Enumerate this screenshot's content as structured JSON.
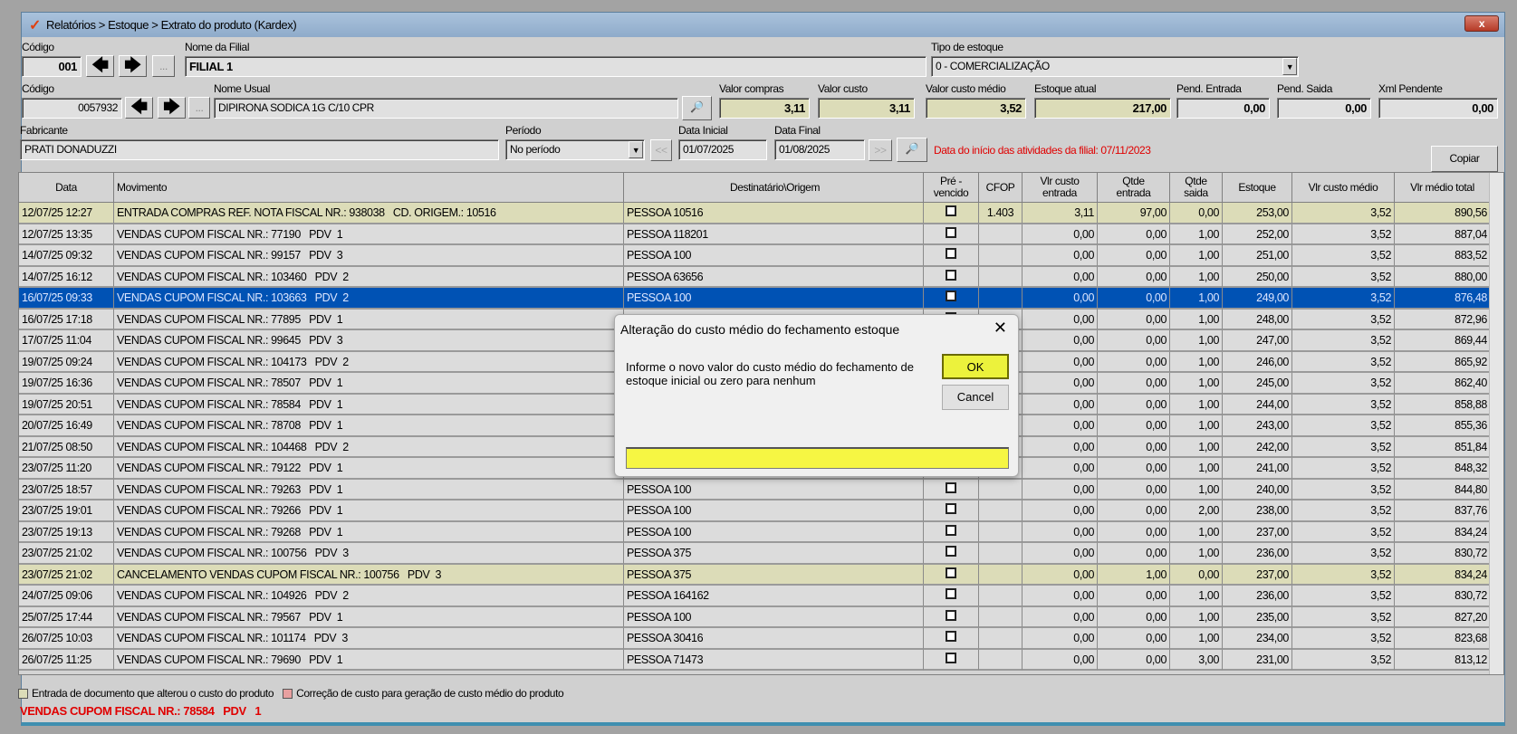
{
  "window": {
    "title": "Relatórios > Estoque > Extrato do produto (Kardex)",
    "close": "x"
  },
  "filial": {
    "codigo_label": "Código",
    "codigo": "001",
    "nome_label": "Nome da Filial",
    "nome": "FILIAL 1",
    "more": "..."
  },
  "tipo_estoque": {
    "label": "Tipo de estoque",
    "value": "0 - COMERCIALIZAÇÃO"
  },
  "produto": {
    "codigo_label": "Código",
    "codigo": "0057932",
    "nome_label": "Nome Usual",
    "nome": "DIPIRONA SODICA 1G C/10 CPR",
    "more": "..."
  },
  "valores": {
    "valor_compras_label": "Valor compras",
    "valor_compras": "3,11",
    "valor_custo_label": "Valor custo",
    "valor_custo": "3,11",
    "valor_custo_medio_label": "Valor custo médio",
    "valor_custo_medio": "3,52",
    "estoque_atual_label": "Estoque atual",
    "estoque_atual": "217,00",
    "pend_entrada_label": "Pend. Entrada",
    "pend_entrada": "0,00",
    "pend_saida_label": "Pend. Saida",
    "pend_saida": "0,00",
    "xml_pendente_label": "Xml Pendente",
    "xml_pendente": "0,00"
  },
  "fabricante": {
    "label": "Fabricante",
    "value": "PRATI DONADUZZI"
  },
  "periodo": {
    "label": "Período",
    "value": "No período",
    "prev": "<<",
    "next": ">>"
  },
  "datas": {
    "inicial_label": "Data Inicial",
    "inicial": "01/07/2025",
    "final_label": "Data Final",
    "final": "01/08/2025"
  },
  "aviso": "Data do início das atividades da filial: 07/11/2023",
  "copiar": "Copiar",
  "grid": {
    "columns": [
      "Data",
      "Movimento",
      "Destinatário\\Origem",
      "Pré -\nvencido",
      "CFOP",
      "Vlr custo\nentrada",
      "Qtde\nentrada",
      "Qtde\nsaida",
      "Estoque",
      "Vlr custo médio",
      "Vlr médio total"
    ],
    "rows": [
      {
        "style": "yel",
        "data": "12/07/25 12:27",
        "mov": "ENTRADA COMPRAS REF. NOTA FISCAL NR.: 938038   CD. ORIGEM.: 10516",
        "dest": "PESSOA 10516",
        "cfop": "1.403",
        "vce": "3,11",
        "qe": "97,00",
        "qs": "0,00",
        "est": "253,00",
        "vcm": "3,52",
        "vmt": "890,56"
      },
      {
        "style": "norm",
        "data": "12/07/25 13:35",
        "mov": "VENDAS CUPOM FISCAL NR.: 77190   PDV  1",
        "dest": "PESSOA 118201",
        "cfop": "",
        "vce": "0,00",
        "qe": "0,00",
        "qs": "1,00",
        "est": "252,00",
        "vcm": "3,52",
        "vmt": "887,04"
      },
      {
        "style": "norm",
        "data": "14/07/25 09:32",
        "mov": "VENDAS CUPOM FISCAL NR.: 99157   PDV  3",
        "dest": "PESSOA 100",
        "cfop": "",
        "vce": "0,00",
        "qe": "0,00",
        "qs": "1,00",
        "est": "251,00",
        "vcm": "3,52",
        "vmt": "883,52"
      },
      {
        "style": "norm",
        "data": "14/07/25 16:12",
        "mov": "VENDAS CUPOM FISCAL NR.: 103460   PDV  2",
        "dest": "PESSOA 63656",
        "cfop": "",
        "vce": "0,00",
        "qe": "0,00",
        "qs": "1,00",
        "est": "250,00",
        "vcm": "3,52",
        "vmt": "880,00"
      },
      {
        "style": "sel",
        "data": "16/07/25 09:33",
        "mov": "VENDAS CUPOM FISCAL NR.: 103663   PDV  2",
        "dest": "PESSOA 100",
        "cfop": "",
        "vce": "0,00",
        "qe": "0,00",
        "qs": "1,00",
        "est": "249,00",
        "vcm": "3,52",
        "vmt": "876,48"
      },
      {
        "style": "norm",
        "data": "16/07/25 17:18",
        "mov": "VENDAS CUPOM FISCAL NR.: 77895   PDV  1",
        "dest": "",
        "cfop": "",
        "vce": "0,00",
        "qe": "0,00",
        "qs": "1,00",
        "est": "248,00",
        "vcm": "3,52",
        "vmt": "872,96"
      },
      {
        "style": "norm",
        "data": "17/07/25 11:04",
        "mov": "VENDAS CUPOM FISCAL NR.: 99645   PDV  3",
        "dest": "",
        "cfop": "",
        "vce": "0,00",
        "qe": "0,00",
        "qs": "1,00",
        "est": "247,00",
        "vcm": "3,52",
        "vmt": "869,44"
      },
      {
        "style": "norm",
        "data": "19/07/25 09:24",
        "mov": "VENDAS CUPOM FISCAL NR.: 104173   PDV  2",
        "dest": "",
        "cfop": "",
        "vce": "0,00",
        "qe": "0,00",
        "qs": "1,00",
        "est": "246,00",
        "vcm": "3,52",
        "vmt": "865,92"
      },
      {
        "style": "norm",
        "data": "19/07/25 16:36",
        "mov": "VENDAS CUPOM FISCAL NR.: 78507   PDV  1",
        "dest": "",
        "cfop": "",
        "vce": "0,00",
        "qe": "0,00",
        "qs": "1,00",
        "est": "245,00",
        "vcm": "3,52",
        "vmt": "862,40"
      },
      {
        "style": "norm",
        "data": "19/07/25 20:51",
        "mov": "VENDAS CUPOM FISCAL NR.: 78584   PDV  1",
        "dest": "",
        "cfop": "",
        "vce": "0,00",
        "qe": "0,00",
        "qs": "1,00",
        "est": "244,00",
        "vcm": "3,52",
        "vmt": "858,88"
      },
      {
        "style": "norm",
        "data": "20/07/25 16:49",
        "mov": "VENDAS CUPOM FISCAL NR.: 78708   PDV  1",
        "dest": "",
        "cfop": "",
        "vce": "0,00",
        "qe": "0,00",
        "qs": "1,00",
        "est": "243,00",
        "vcm": "3,52",
        "vmt": "855,36"
      },
      {
        "style": "norm",
        "data": "21/07/25 08:50",
        "mov": "VENDAS CUPOM FISCAL NR.: 104468   PDV  2",
        "dest": "",
        "cfop": "",
        "vce": "0,00",
        "qe": "0,00",
        "qs": "1,00",
        "est": "242,00",
        "vcm": "3,52",
        "vmt": "851,84"
      },
      {
        "style": "norm",
        "data": "23/07/25 11:20",
        "mov": "VENDAS CUPOM FISCAL NR.: 79122   PDV  1",
        "dest": "",
        "cfop": "",
        "vce": "0,00",
        "qe": "0,00",
        "qs": "1,00",
        "est": "241,00",
        "vcm": "3,52",
        "vmt": "848,32"
      },
      {
        "style": "norm",
        "data": "23/07/25 18:57",
        "mov": "VENDAS CUPOM FISCAL NR.: 79263   PDV  1",
        "dest": "PESSOA 100",
        "cfop": "",
        "vce": "0,00",
        "qe": "0,00",
        "qs": "1,00",
        "est": "240,00",
        "vcm": "3,52",
        "vmt": "844,80"
      },
      {
        "style": "norm",
        "data": "23/07/25 19:01",
        "mov": "VENDAS CUPOM FISCAL NR.: 79266   PDV  1",
        "dest": "PESSOA 100",
        "cfop": "",
        "vce": "0,00",
        "qe": "0,00",
        "qs": "2,00",
        "est": "238,00",
        "vcm": "3,52",
        "vmt": "837,76"
      },
      {
        "style": "norm",
        "data": "23/07/25 19:13",
        "mov": "VENDAS CUPOM FISCAL NR.: 79268   PDV  1",
        "dest": "PESSOA 100",
        "cfop": "",
        "vce": "0,00",
        "qe": "0,00",
        "qs": "1,00",
        "est": "237,00",
        "vcm": "3,52",
        "vmt": "834,24"
      },
      {
        "style": "norm",
        "data": "23/07/25 21:02",
        "mov": "VENDAS CUPOM FISCAL NR.: 100756   PDV  3",
        "dest": "PESSOA 375",
        "cfop": "",
        "vce": "0,00",
        "qe": "0,00",
        "qs": "1,00",
        "est": "236,00",
        "vcm": "3,52",
        "vmt": "830,72"
      },
      {
        "style": "yel",
        "data": "23/07/25 21:02",
        "mov": "CANCELAMENTO VENDAS CUPOM FISCAL NR.: 100756   PDV  3",
        "dest": "PESSOA 375",
        "cfop": "",
        "vce": "0,00",
        "qe": "1,00",
        "qs": "0,00",
        "est": "237,00",
        "vcm": "3,52",
        "vmt": "834,24"
      },
      {
        "style": "norm",
        "data": "24/07/25 09:06",
        "mov": "VENDAS CUPOM FISCAL NR.: 104926   PDV  2",
        "dest": "PESSOA 164162",
        "cfop": "",
        "vce": "0,00",
        "qe": "0,00",
        "qs": "1,00",
        "est": "236,00",
        "vcm": "3,52",
        "vmt": "830,72"
      },
      {
        "style": "norm",
        "data": "25/07/25 17:44",
        "mov": "VENDAS CUPOM FISCAL NR.: 79567   PDV  1",
        "dest": "PESSOA 100",
        "cfop": "",
        "vce": "0,00",
        "qe": "0,00",
        "qs": "1,00",
        "est": "235,00",
        "vcm": "3,52",
        "vmt": "827,20"
      },
      {
        "style": "norm",
        "data": "26/07/25 10:03",
        "mov": "VENDAS CUPOM FISCAL NR.: 101174   PDV  3",
        "dest": "PESSOA 30416",
        "cfop": "",
        "vce": "0,00",
        "qe": "0,00",
        "qs": "1,00",
        "est": "234,00",
        "vcm": "3,52",
        "vmt": "823,68"
      },
      {
        "style": "norm",
        "data": "26/07/25 11:25",
        "mov": "VENDAS CUPOM FISCAL NR.: 79690   PDV  1",
        "dest": "PESSOA 71473",
        "cfop": "",
        "vce": "0,00",
        "qe": "0,00",
        "qs": "3,00",
        "est": "231,00",
        "vcm": "3,52",
        "vmt": "813,12"
      }
    ]
  },
  "legend": {
    "entrada": "Entrada de documento que alterou o custo do produto",
    "correcao": "Correção de custo para geração de custo médio do produto",
    "entrada_color": "#dcdcb8",
    "correcao_color": "#e8a0a0"
  },
  "status_text": "VENDAS CUPOM FISCAL NR.: 78584   PDV   1",
  "dialog": {
    "title": "Alteração do custo médio do fechamento estoque",
    "close": "✕",
    "message": "Informe o novo valor do custo médio do fechamento de estoque inicial ou zero para nenhum",
    "ok": "OK",
    "cancel": "Cancel",
    "input_value": ""
  },
  "colors": {
    "selected": "#0052b4",
    "highlight": "#dcdcb8",
    "warning": "#e00000"
  }
}
